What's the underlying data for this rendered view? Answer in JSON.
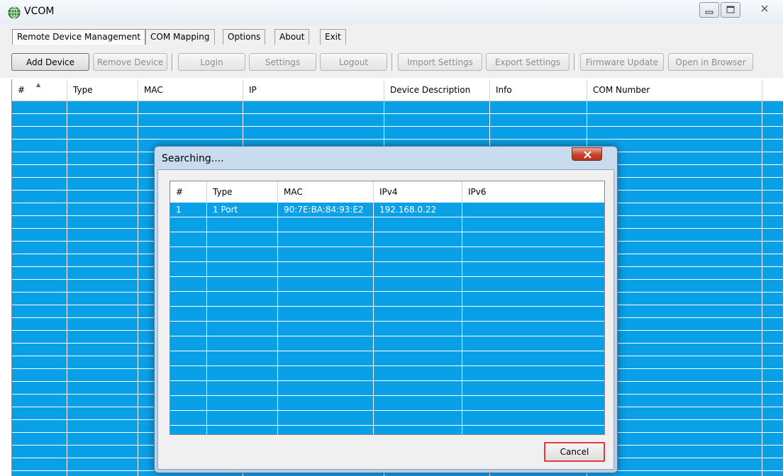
{
  "window": {
    "title": "VCOM",
    "icon": "globe-app-icon"
  },
  "menu": {
    "tabs": [
      {
        "label": "Remote Device Management",
        "active": true
      },
      {
        "label": "COM Mapping",
        "active": false
      },
      {
        "label": "Options",
        "active": false
      },
      {
        "label": "About",
        "active": false
      },
      {
        "label": "Exit",
        "active": false
      }
    ]
  },
  "toolbar": {
    "buttons": [
      {
        "label": "Add Device",
        "enabled": true
      },
      {
        "label": "Remove Device",
        "enabled": false
      },
      {
        "label": "Login",
        "enabled": false
      },
      {
        "label": "Settings",
        "enabled": false
      },
      {
        "label": "Logout",
        "enabled": false
      },
      {
        "label": "Import Settings",
        "enabled": false
      },
      {
        "label": "Export Settings",
        "enabled": false
      },
      {
        "label": "Firmware Update",
        "enabled": false
      },
      {
        "label": "Open in Browser",
        "enabled": false
      }
    ]
  },
  "device_table": {
    "columns": [
      "#",
      "Type",
      "MAC",
      "IP",
      "Device Description",
      "Info",
      "COM Number"
    ],
    "rows": []
  },
  "search_dialog": {
    "title": "Searching....",
    "columns": [
      "#",
      "Type",
      "MAC",
      "IPv4",
      "IPv6"
    ],
    "rows": [
      [
        "1",
        "1 Port",
        "90:7E:BA:84:93:E2",
        "192.168.0.22",
        ""
      ]
    ],
    "cancel_label": "Cancel"
  },
  "colors": {
    "grid_fill": "#0aa0e8",
    "highlight": "#e53a3a"
  }
}
